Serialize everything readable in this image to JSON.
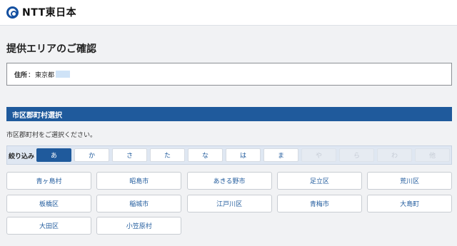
{
  "header": {
    "logo_text": "NTT東日本"
  },
  "page": {
    "title": "提供エリアのご確認",
    "address": {
      "label": "住所",
      "separator": "：",
      "value": "東京都",
      "highlight": "　　"
    }
  },
  "section": {
    "title": "市区郡町村選択",
    "instruction": "市区郡町村をご選択ください。"
  },
  "filter": {
    "label": "絞り込み",
    "buttons": [
      {
        "label": "あ",
        "state": "active"
      },
      {
        "label": "か",
        "state": "enabled"
      },
      {
        "label": "さ",
        "state": "enabled"
      },
      {
        "label": "た",
        "state": "enabled"
      },
      {
        "label": "な",
        "state": "enabled"
      },
      {
        "label": "は",
        "state": "enabled"
      },
      {
        "label": "ま",
        "state": "enabled"
      },
      {
        "label": "や",
        "state": "disabled"
      },
      {
        "label": "ら",
        "state": "disabled"
      },
      {
        "label": "わ",
        "state": "disabled"
      },
      {
        "label": "他",
        "state": "disabled"
      }
    ]
  },
  "municipalities": [
    "青ヶ島村",
    "昭島市",
    "あきる野市",
    "足立区",
    "荒川区",
    "板橋区",
    "稲城市",
    "江戸川区",
    "青梅市",
    "大島町",
    "大田区",
    "小笠原村"
  ]
}
